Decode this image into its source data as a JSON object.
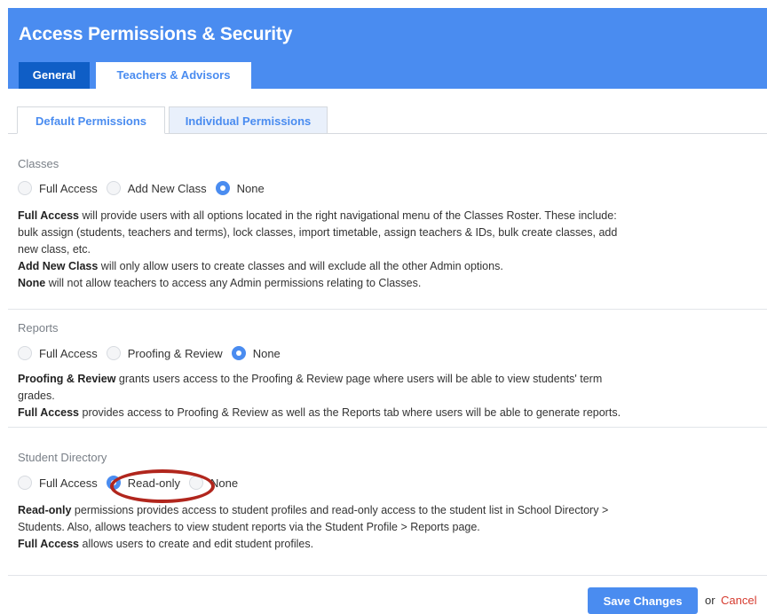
{
  "header": {
    "title": "Access Permissions & Security",
    "tabs": [
      {
        "label": "General",
        "active": true
      },
      {
        "label": "Teachers & Advisors",
        "active": false
      }
    ]
  },
  "subtabs": [
    {
      "label": "Default Permissions",
      "active": true
    },
    {
      "label": "Individual Permissions",
      "active": false
    }
  ],
  "sections": [
    {
      "title": "Classes",
      "options": [
        "Full Access",
        "Add New Class",
        "None"
      ],
      "selected": "None",
      "desc": {
        "l1_b": "Full Access",
        "l1_t": " will provide users with all options located in the right navigational menu of the Classes Roster. These include:",
        "l2_t": "bulk assign (students, teachers and terms), lock classes, import timetable, assign teachers & IDs, bulk create classes, add",
        "l3_t": "new class, etc.",
        "l4_b": "Add New Class",
        "l4_t": " will only allow users to create classes and will exclude all the other Admin options.",
        "l5_b": "None",
        "l5_t": " will not allow teachers to access any Admin permissions relating to Classes."
      }
    },
    {
      "title": "Reports",
      "options": [
        "Full Access",
        "Proofing & Review",
        "None"
      ],
      "selected": "None",
      "desc": {
        "l1_b": "Proofing & Review",
        "l1_t": " grants users access to the Proofing & Review page where users will be able to view students' term",
        "l2_t": "grades.",
        "l3_b": "Full Access",
        "l3_t": " provides access to Proofing & Review as well as the Reports tab where users will be able to generate reports."
      }
    },
    {
      "title": "Student Directory",
      "options": [
        "Full Access",
        "Read-only",
        "None"
      ],
      "selected": "Read-only",
      "desc": {
        "l1_b": "Read-only",
        "l1_t": " permissions provides access to student profiles and read-only access to the student list in School Directory >",
        "l2_t": "Students. Also, allows teachers to view student reports via the Student Profile > Reports page.",
        "l3_b": "Full Access",
        "l3_t": " allows users to create and edit student profiles."
      }
    }
  ],
  "footer": {
    "save_label": "Save Changes",
    "or_text": "or",
    "cancel_label": "Cancel"
  },
  "colors": {
    "header_bg": "#4a8cf0",
    "active_tab_bg": "#0f5ec6",
    "radio_checked": "#4a8cf0",
    "cancel": "#d63b2f",
    "annotation": "#b1261d"
  },
  "icons": {
    "radio_unchecked": "radio-unchecked-icon",
    "radio_checked": "radio-checked-icon"
  }
}
